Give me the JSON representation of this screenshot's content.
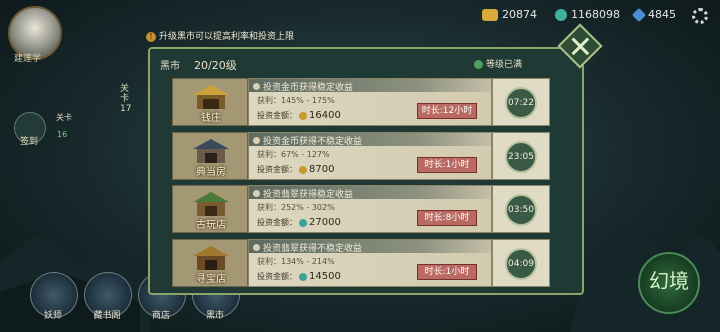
{
  "player": {
    "name": "建莲学"
  },
  "hint": "升级黑市可以提高利率和投资上限",
  "resources": [
    {
      "name": "gold",
      "icon": "gold-ingot-icon",
      "value": "20874",
      "color": "#d9a93a"
    },
    {
      "name": "jade",
      "icon": "jade-coin-icon",
      "value": "1168098",
      "color": "#3fb0a0"
    },
    {
      "name": "gem",
      "icon": "gem-icon",
      "value": "4845",
      "color": "#4a8fd6"
    }
  ],
  "left_widgets": {
    "checkin_label": "签到",
    "checkin_count": "16",
    "level_label": "关卡 17",
    "small_label": "关卡"
  },
  "panel": {
    "title": "黑市",
    "level": "20/20级",
    "maxed_label": "等级已满"
  },
  "rows": [
    {
      "name": "钱庄",
      "title": "投资金币获得稳定收益",
      "profit": "获利：145% - 175%",
      "invest_label": "投资金额：",
      "coin": "gold",
      "coin_color": "#c79a2c",
      "amount": "16400",
      "duration": "时长:12小时",
      "timer": "07:22"
    },
    {
      "name": "典当房",
      "title": "投资金币获得不稳定收益",
      "profit": "获利：67% - 127%",
      "invest_label": "投资金额：",
      "coin": "gold",
      "coin_color": "#c79a2c",
      "amount": "8700",
      "duration": "时长:1小时",
      "timer": "23:05"
    },
    {
      "name": "古玩店",
      "title": "投资翡翠获得稳定收益",
      "profit": "获利：252% - 302%",
      "invest_label": "投资金额：",
      "coin": "jade",
      "coin_color": "#3aa39a",
      "amount": "27000",
      "duration": "时长:8小时",
      "timer": "03:50"
    },
    {
      "name": "寻宝店",
      "title": "投资翡翠获得不稳定收益",
      "profit": "获利：134% - 214%",
      "invest_label": "投资金额：",
      "coin": "jade",
      "coin_color": "#3aa39a",
      "amount": "14500",
      "duration": "时长:1小时",
      "timer": "04:09"
    }
  ],
  "bottom_nav": [
    {
      "label": "妖师",
      "icon": "demon-master-icon"
    },
    {
      "label": "藏书阁",
      "icon": "library-icon"
    },
    {
      "label": "商店",
      "icon": "shop-icon"
    },
    {
      "label": "黑市",
      "icon": "black-market-icon"
    }
  ],
  "magic_button": {
    "label": "幻境"
  }
}
